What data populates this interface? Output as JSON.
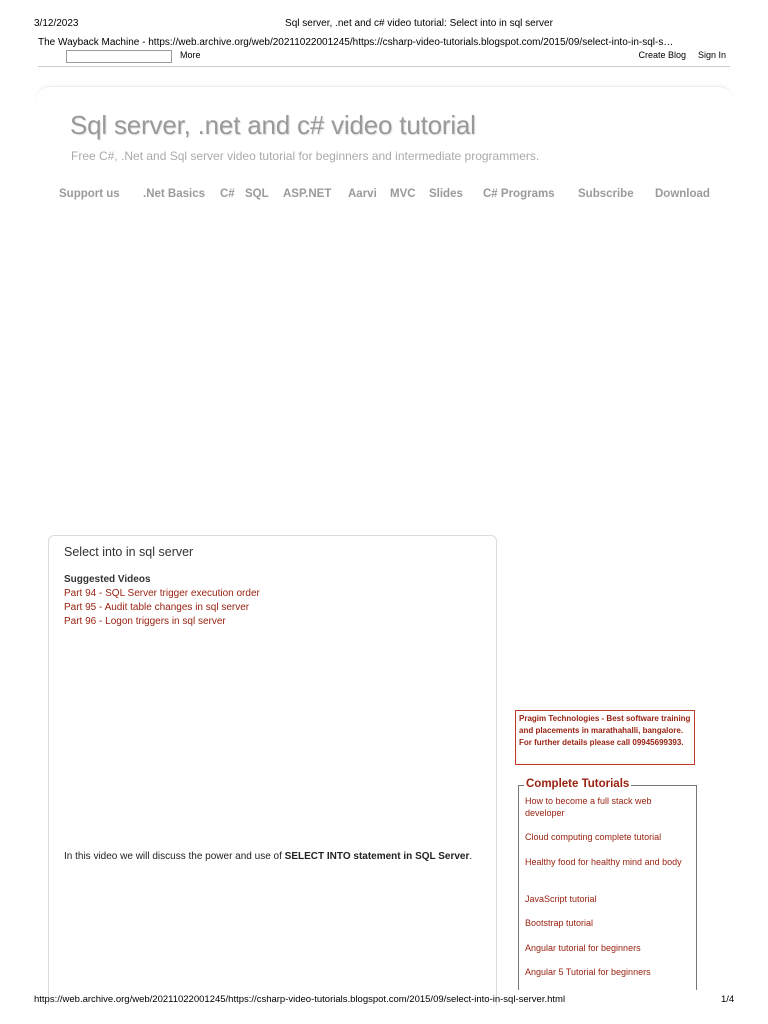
{
  "print": {
    "date": "3/12/2023",
    "title": "Sql server, .net and c# video tutorial: Select into in sql server",
    "footer_url": "https://web.archive.org/web/20211022001245/https://csharp-video-tutorials.blogspot.com/2015/09/select-into-in-sql-server.html",
    "page_number": "1/4"
  },
  "wayback": {
    "line": "The Wayback Machine - https://web.archive.org/web/20211022001245/https://csharp-video-tutorials.blogspot.com/2015/09/select-into-in-sql-s…",
    "more_label": "More",
    "create_blog_label": "Create Blog",
    "sign_in_label": "Sign In"
  },
  "blog": {
    "title": "Sql server, .net and c# video tutorial",
    "description": "Free C#, .Net and Sql server video tutorial for beginners and intermediate programmers."
  },
  "nav": [
    {
      "label": "Support us"
    },
    {
      "label": ".Net Basics"
    },
    {
      "label": "C#"
    },
    {
      "label": "SQL"
    },
    {
      "label": "ASP.NET"
    },
    {
      "label": "Aarvi"
    },
    {
      "label": "MVC"
    },
    {
      "label": "Slides"
    },
    {
      "label": "C# Programs"
    },
    {
      "label": "Subscribe"
    },
    {
      "label": "Download"
    }
  ],
  "post": {
    "title": "Select into in sql server",
    "suggested_heading": "Suggested Videos",
    "suggested": [
      {
        "label": "Part 94 - SQL Server trigger execution order"
      },
      {
        "label": "Part 95 - Audit table changes in sql server"
      },
      {
        "label": "Part 96 - Logon triggers in sql server"
      }
    ],
    "body_prefix": "In this video we will discuss the power and use of ",
    "body_bold": "SELECT INTO statement in SQL Server",
    "body_suffix": "."
  },
  "sidebar": {
    "ad_text": "Pragim Technologies - Best software training and placements in marathahalli, bangalore. For further details please call 09945699393.",
    "tutorials_heading": "Complete Tutorials",
    "tutorials": [
      {
        "label": "How to become a full stack web developer"
      },
      {
        "label": "Cloud computing complete tutorial"
      },
      {
        "label": "Healthy food for healthy mind and body"
      },
      {
        "label": "JavaScript tutorial"
      },
      {
        "label": "Bootstrap tutorial"
      },
      {
        "label": "Angular tutorial for beginners"
      },
      {
        "label": "Angular 5 Tutorial for beginners"
      }
    ]
  },
  "colors": {
    "link": "#992211",
    "nav_text": "#9a9a9a",
    "title_text": "#999999"
  }
}
